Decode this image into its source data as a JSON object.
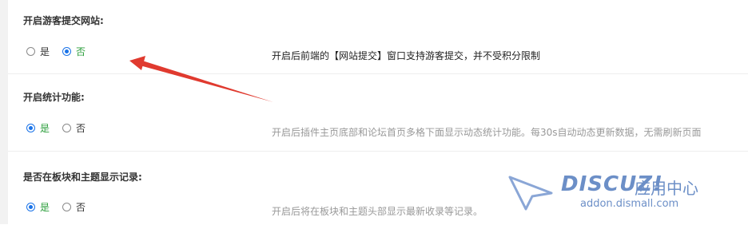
{
  "settings": [
    {
      "title": "开启游客提交网站:",
      "options": [
        {
          "label": "是",
          "checked": false
        },
        {
          "label": "否",
          "checked": true
        }
      ],
      "description": "开启后前端的【网站提交】窗口支持游客提交，并不受积分限制"
    },
    {
      "title": "开启统计功能:",
      "options": [
        {
          "label": "是",
          "checked": true
        },
        {
          "label": "否",
          "checked": false
        }
      ],
      "description": "开启后插件主页底部和论坛首页多格下面显示动态统计功能。每30s自动动态更新数据，无需刷新页面"
    },
    {
      "title": "是否在板块和主题显示记录:",
      "options": [
        {
          "label": "是",
          "checked": true
        },
        {
          "label": "否",
          "checked": false
        }
      ],
      "description": "开启后将在板块和主题头部显示最新收录等记录。"
    }
  ],
  "watermark": {
    "brand": "DISCUZ!",
    "tagline": "应用中心",
    "url": "addon.dismall.com"
  },
  "colors": {
    "accent": "#1a73e8",
    "active_label": "#2a9d3a",
    "arrow": "#e03a2f",
    "watermark": "#6c8fc7"
  }
}
